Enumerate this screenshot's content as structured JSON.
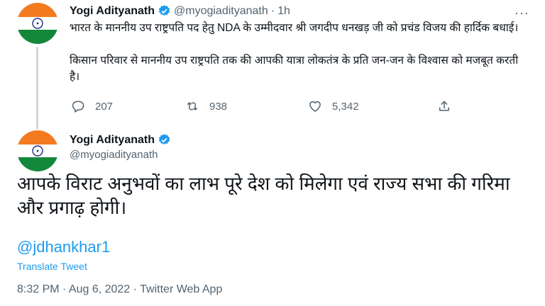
{
  "colors": {
    "accent": "#1d9bf0",
    "muted": "#536471",
    "text": "#0f1419",
    "line": "#cfd9de"
  },
  "icons": {
    "verified": "verified-badge-icon",
    "reply": "reply-icon",
    "retweet": "retweet-icon",
    "like": "heart-icon",
    "share": "share-icon",
    "more": "more-icon"
  },
  "tweet1": {
    "name": "Yogi Adityanath",
    "handle": "@myogiadityanath",
    "separator": "·",
    "time": "1h",
    "more": "···",
    "paragraphs": [
      "भारत के माननीय उप राष्ट्रपति पद हेतु NDA के उम्मीदवार श्री जगदीप धनखड़ जी को प्रचंड विजय की हार्दिक बधाई।",
      "किसान परिवार से माननीय उप राष्ट्रपति तक की आपकी यात्रा लोकतंत्र के प्रति जन-जन के विश्वास को मजबूत करती है।"
    ],
    "replies": "207",
    "retweets": "938",
    "likes": "5,342"
  },
  "tweet2": {
    "name": "Yogi Adityanath",
    "handle": "@myogiadityanath",
    "text": "आपके विराट अनुभवों का लाभ पूरे देश को मिलेगा एवं राज्य सभा की गरिमा और प्रगाढ़ होगी।",
    "mention": "@jdhankhar1",
    "translate": "Translate Tweet",
    "timestamp": "8:32 PM · Aug 6, 2022 · Twitter Web App"
  }
}
